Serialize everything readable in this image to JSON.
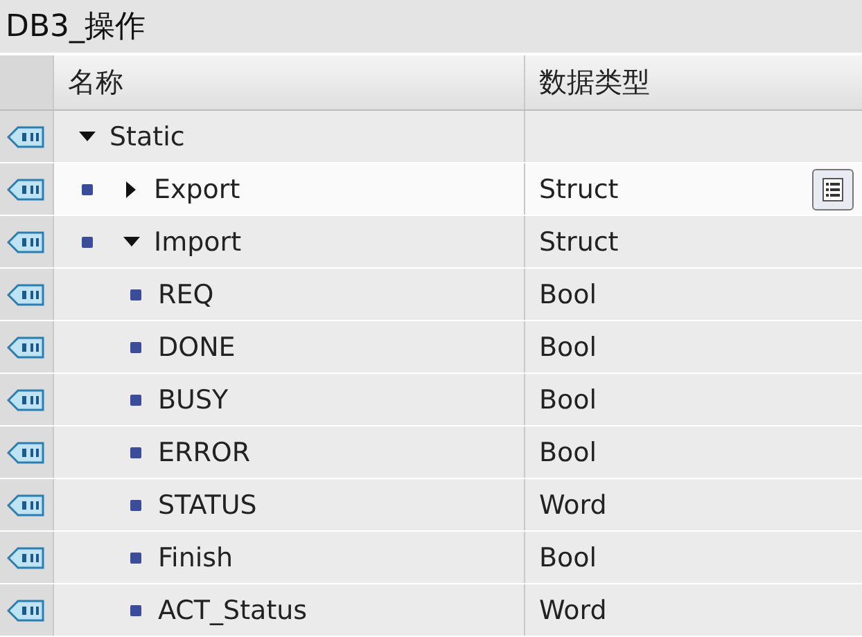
{
  "window": {
    "title": "DB3_操作"
  },
  "table": {
    "columns": [
      "名称",
      "数据类型"
    ],
    "rows": [
      {
        "name": "Static",
        "expanded": true,
        "selected": false,
        "children": [
          {
            "name": "Export",
            "type": "Struct",
            "expanded": false,
            "selected": true
          },
          {
            "name": "Import",
            "type": "Struct",
            "expanded": true,
            "selected": false,
            "children": [
              {
                "name": "REQ",
                "type": "Bool",
                "selected": false
              },
              {
                "name": "DONE",
                "type": "Bool",
                "selected": false
              },
              {
                "name": "BUSY",
                "type": "Bool",
                "selected": false
              },
              {
                "name": "ERROR",
                "type": "Bool",
                "selected": false
              },
              {
                "name": "STATUS",
                "type": "Word",
                "selected": false
              },
              {
                "name": "Finish",
                "type": "Bool",
                "selected": false
              },
              {
                "name": "ACT_Status",
                "type": "Word",
                "selected": false
              }
            ]
          }
        ]
      }
    ]
  }
}
